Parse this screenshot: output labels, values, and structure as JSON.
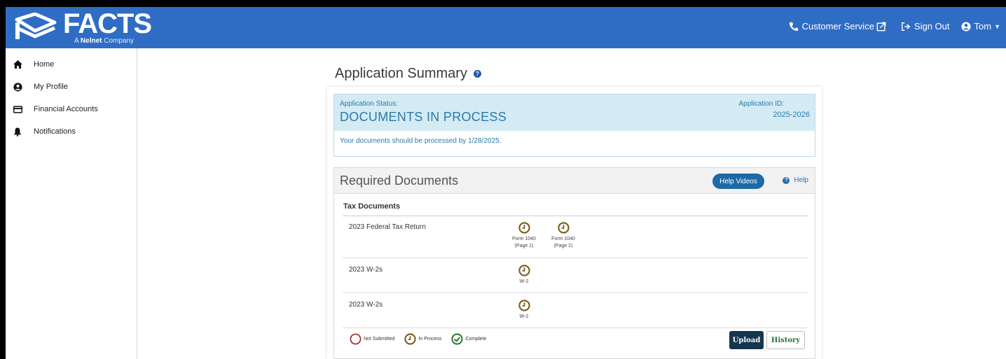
{
  "header": {
    "brand": "FACTS",
    "brand_sub_prefix": "A",
    "brand_sub_name": "Nelnet",
    "brand_sub_suffix": "Company",
    "customer_service": "Customer Service",
    "sign_out": "Sign Out",
    "user": "Tom"
  },
  "sidebar": {
    "items": [
      {
        "label": "Home",
        "icon": "home-icon"
      },
      {
        "label": "My Profile",
        "icon": "user-circle-icon"
      },
      {
        "label": "Financial Accounts",
        "icon": "credit-card-icon"
      },
      {
        "label": "Notifications",
        "icon": "bell-icon"
      }
    ]
  },
  "main": {
    "title": "Application Summary",
    "status": {
      "label": "Application Status:",
      "value": "DOCUMENTS IN PROCESS",
      "id_label": "Application ID:",
      "id_value": "2025-2026",
      "message": "Your documents should be processed by 1/28/2025."
    },
    "required": {
      "title": "Required Documents",
      "help_videos": "Help Videos",
      "help": "Help",
      "section": "Tax Documents",
      "rows": [
        {
          "name": "2023 Federal Tax Return",
          "items": [
            {
              "line1": "Form 1040",
              "line2": "(Page 1)",
              "status": "in-process"
            },
            {
              "line1": "Form 1040",
              "line2": "(Page 2)",
              "status": "in-process"
            }
          ]
        },
        {
          "name": "2023 W-2s",
          "items": [
            {
              "line1": "W-2",
              "line2": "",
              "status": "in-process"
            }
          ]
        },
        {
          "name": "2023 W-2s",
          "items": [
            {
              "line1": "W-2",
              "line2": "",
              "status": "in-process"
            }
          ]
        }
      ],
      "legend": {
        "not_submitted": "Not Submitted",
        "in_process": "In Process",
        "complete": "Complete"
      },
      "upload": "Upload",
      "history": "History"
    }
  },
  "colors": {
    "header_bg": "#2f6dc4",
    "in_process": "#7a5a1e",
    "not_submitted": "#a52a2a",
    "complete": "#2e7d32",
    "status_text": "#2a7aa8"
  }
}
